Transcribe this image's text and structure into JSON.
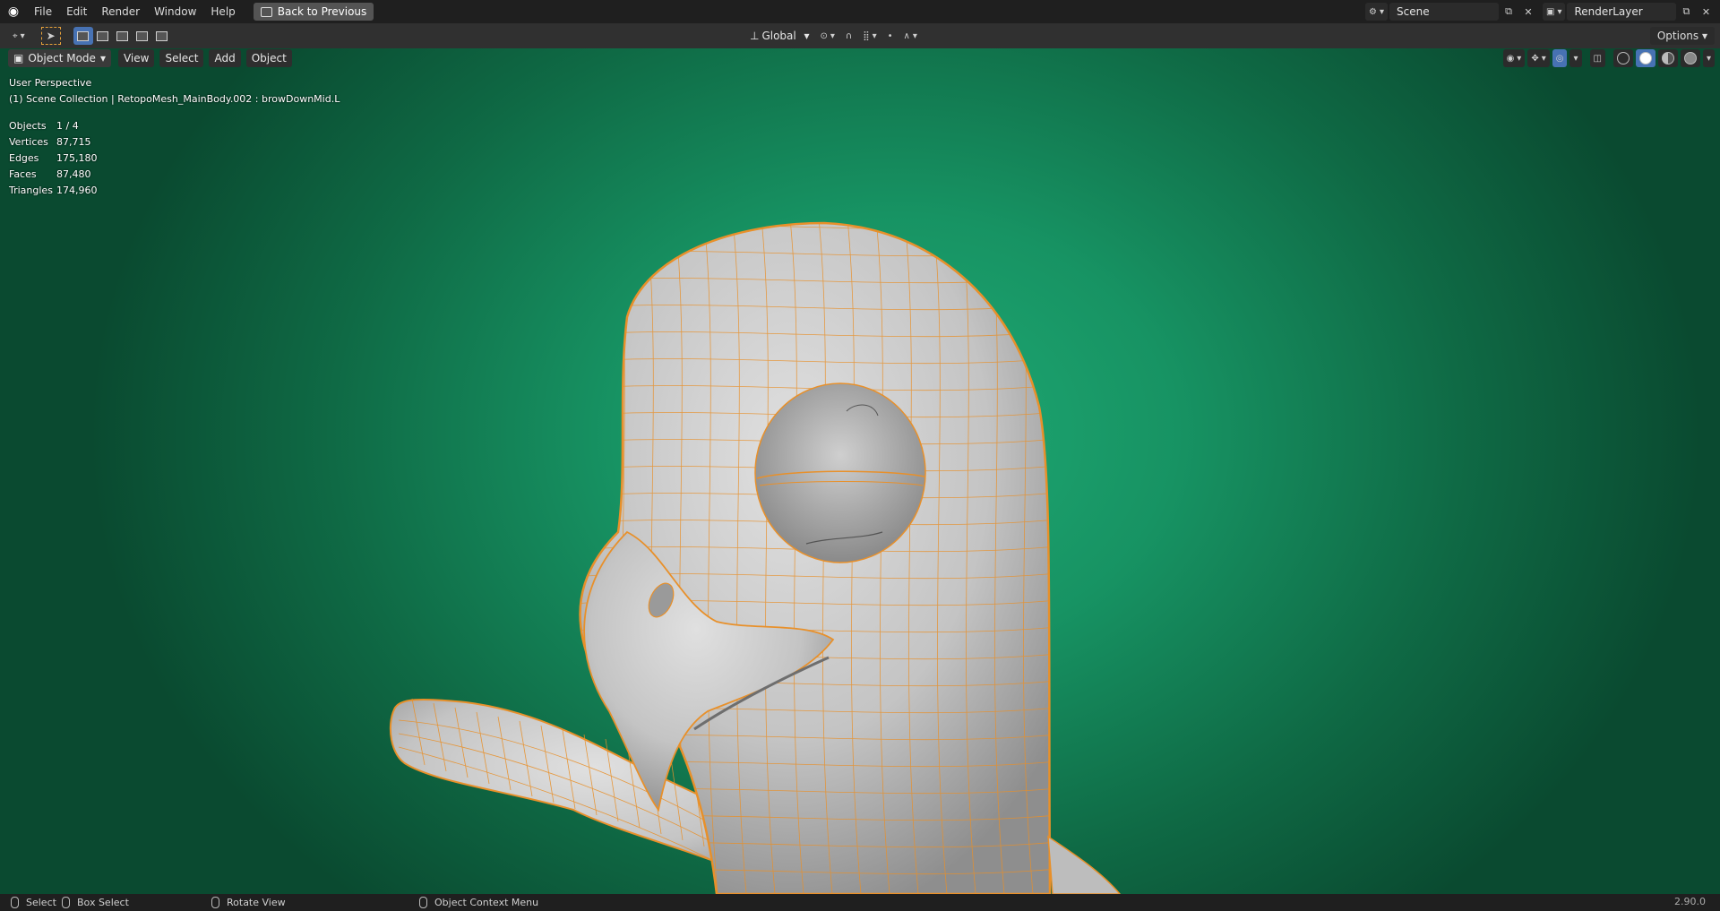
{
  "topbar": {
    "menu": [
      "File",
      "Edit",
      "Render",
      "Window",
      "Help"
    ],
    "back_button": "Back to Previous",
    "scene": "Scene",
    "render_layer": "RenderLayer"
  },
  "toolbar": {
    "orientation": "Global",
    "options": "Options"
  },
  "viewport": {
    "mode": "Object Mode",
    "menus": [
      "View",
      "Select",
      "Add",
      "Object"
    ],
    "perspective": "User Perspective",
    "collection_info": "(1) Scene Collection | RetopoMesh_MainBody.002 : browDownMid.L",
    "stats": [
      {
        "label": "Objects",
        "value": "1 / 4"
      },
      {
        "label": "Vertices",
        "value": "87,715"
      },
      {
        "label": "Edges",
        "value": "175,180"
      },
      {
        "label": "Faces",
        "value": "87,480"
      },
      {
        "label": "Triangles",
        "value": "174,960"
      }
    ],
    "colors": {
      "bg_center": "#1faa74",
      "bg_edge": "#0a4a30",
      "wire": "#e8902a",
      "mesh": "#cfcfcf"
    }
  },
  "statusbar": {
    "select": "Select",
    "box_select": "Box Select",
    "rotate": "Rotate View",
    "context_menu": "Object Context Menu",
    "version": "2.90.0"
  }
}
